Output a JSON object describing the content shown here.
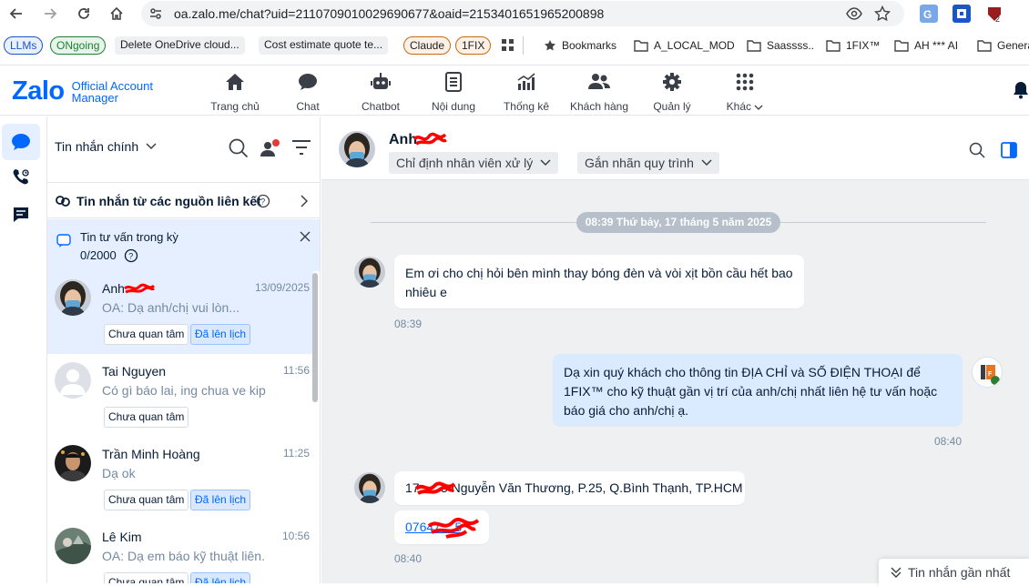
{
  "browser": {
    "url": "oa.zalo.me/chat?uid=2110709010029690677&oaid=2153401651965200898",
    "bookmarks": [
      {
        "label": "LLMs",
        "style": "pill",
        "color": "#1a56c4"
      },
      {
        "label": "ONgoing",
        "style": "pill",
        "color": "#1e7e34"
      },
      {
        "label": "Delete OneDrive cloud...",
        "style": "grey"
      },
      {
        "label": "Cost estimate quote te...",
        "style": "grey"
      },
      {
        "label": "Claude",
        "style": "pill",
        "color": "#c96a12"
      },
      {
        "label": "1FIX",
        "style": "pill",
        "color": "#c96a12"
      }
    ],
    "folders": [
      "Bookmarks",
      "A_LOCAL_MOD",
      "Saassss..",
      "1FIX™",
      "AH *** AI",
      "Genera"
    ]
  },
  "app": {
    "logo": "Zalo",
    "logo_sub1": "Official Account",
    "logo_sub2": "Manager",
    "nav": [
      {
        "label": "Trang chủ",
        "icon": "home-icon"
      },
      {
        "label": "Chat",
        "icon": "chat-icon"
      },
      {
        "label": "Chatbot",
        "icon": "robot-icon"
      },
      {
        "label": "Nội dung",
        "icon": "document-icon"
      },
      {
        "label": "Thống kê",
        "icon": "stats-icon"
      },
      {
        "label": "Khách hàng",
        "icon": "users-icon"
      },
      {
        "label": "Quản lý",
        "icon": "gear-icon"
      },
      {
        "label": "Khác",
        "icon": "grid-icon"
      }
    ]
  },
  "conversation_list": {
    "title": "Tin nhắn chính",
    "linked_sources": "Tin nhắn từ các nguồn liên kết",
    "consult_title": "Tin tư vấn trong kỳ",
    "consult_count": "0/2000",
    "items": [
      {
        "name": "Anh",
        "time": "13/09/2025",
        "preview": "OA: Dạ anh/chị vui lòn...",
        "tags": [
          "Chưa quan tâm",
          "Đã lên lịch"
        ],
        "active": true
      },
      {
        "name": "Tai Nguyen",
        "time": "11:56",
        "preview": "Có gì báo lai, ing chua ve kip",
        "tags": [
          "Chưa quan tâm"
        ],
        "active": false
      },
      {
        "name": "Trần Minh Hoàng",
        "time": "11:25",
        "preview": "Dạ ok",
        "tags": [
          "Chưa quan tâm",
          "Đã lên lịch"
        ],
        "active": false
      },
      {
        "name": "Lê Kim",
        "time": "10:56",
        "preview": "OA: Dạ em báo kỹ thuật liên...",
        "tags": [
          "Chưa quan tâm",
          "Đã lên lịch"
        ],
        "active": false
      }
    ]
  },
  "chat": {
    "contact_name": "Anh",
    "assign_label": "Chỉ định nhân viên xử lý",
    "process_label": "Gắn nhãn quy trình",
    "date_separator": "08:39 Thứ bảy, 17 tháng 5 năm 2025",
    "messages": [
      {
        "text": "Em ơi cho chị hỏi bên mình thay bóng đèn và vòi xịt bồn cầu hết bao nhiêu e",
        "time": "08:39",
        "from": "customer"
      },
      {
        "text": "Dạ xin quý khách cho thông tin ĐỊA CHỈ và SỐ ĐIỆN THOẠI để 1FIX™ cho kỹ thuật gần vị trí của anh/chị nhất liên hệ tư vấn hoặc báo giá cho anh/chị ạ.",
        "time": "08:40",
        "from": "oa"
      },
      {
        "text": "17      3 Nguyễn Văn Thương, P.25, Q.Bình Thạnh, TP.HCM",
        "from": "customer"
      },
      {
        "text": "07647    5",
        "time": "08:40",
        "from": "customer"
      }
    ],
    "latest_button": "Tin nhắn gần nhất"
  }
}
